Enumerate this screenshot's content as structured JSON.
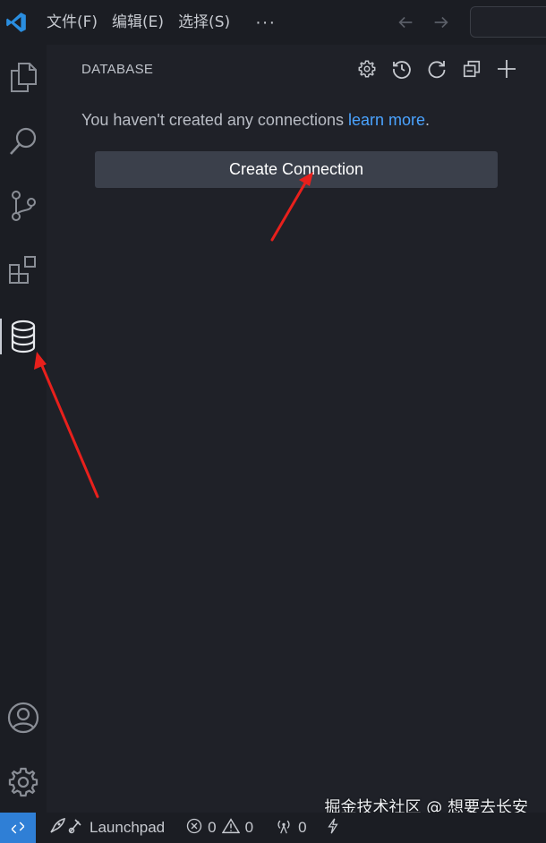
{
  "menu": {
    "file": "文件(F)",
    "edit": "编辑(E)",
    "select": "选择(S)",
    "more": "···"
  },
  "panel": {
    "title": "DATABASE",
    "empty_text": "You haven't created any connections ",
    "learn_more": "learn more",
    "period": ".",
    "create_button": "Create Connection"
  },
  "status": {
    "launchpad": "Launchpad",
    "errors": "0",
    "warnings": "0",
    "ports": "0"
  },
  "watermark": "掘金技术社区 @ 想要去长安",
  "colors": {
    "accent": "#2f7fd6",
    "link": "#4aa3ff",
    "annotation": "#e8201c"
  },
  "icons": {
    "activity": [
      "explorer-icon",
      "search-icon",
      "source-control-icon",
      "extensions-icon",
      "database-icon",
      "account-icon",
      "settings-gear-icon"
    ],
    "panel_actions": [
      "settings-gear-icon",
      "history-icon",
      "refresh-icon",
      "collapse-all-icon",
      "add-icon"
    ]
  }
}
